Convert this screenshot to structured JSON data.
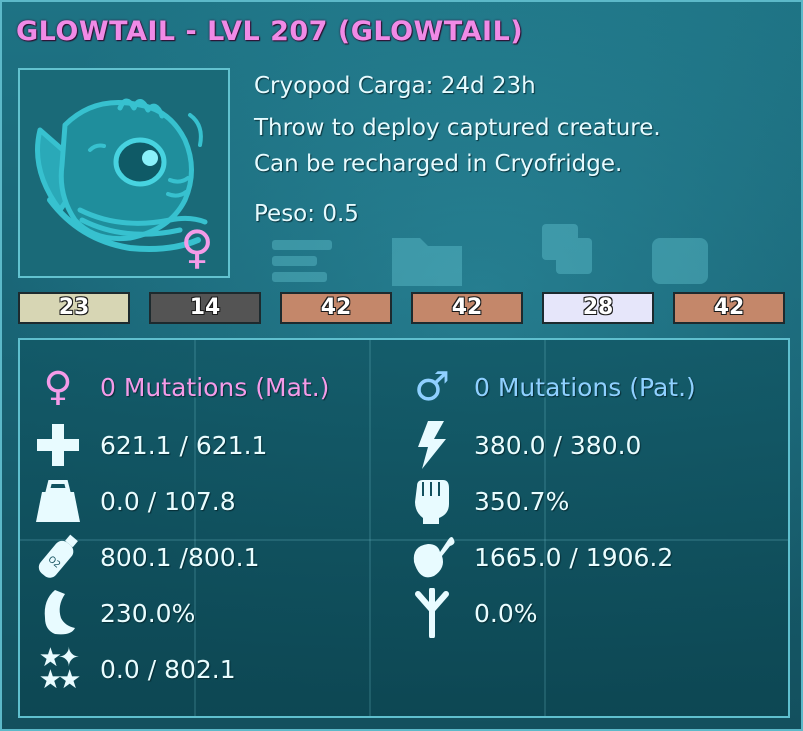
{
  "title": "GLOWTAIL - LVL 207 (GLOWTAIL)",
  "item": {
    "name_line": "Cryopod Carga: 24d 23h",
    "description_line1": "Throw to deploy captured creature.",
    "description_line2": "Can be recharged in Cryofridge.",
    "weight_line": "Peso: 0.5",
    "gender_icon": "female-symbol-icon"
  },
  "colors": [
    {
      "value": "23",
      "color": "#d7d6b4"
    },
    {
      "value": "14",
      "color": "#545454"
    },
    {
      "value": "42",
      "color": "#c4876a"
    },
    {
      "value": "42",
      "color": "#c4876a"
    },
    {
      "value": "28",
      "color": "#e6e6fa"
    },
    {
      "value": "42",
      "color": "#c4876a"
    }
  ],
  "stats": {
    "left": [
      {
        "icon": "female-symbol-icon",
        "text": "0 Mutations (Mat.)"
      },
      {
        "icon": "health-cross-icon",
        "text": "621.1 / 621.1"
      },
      {
        "icon": "weight-icon",
        "text": "0.0 / 107.8"
      },
      {
        "icon": "oxygen-tank-icon",
        "text": "800.1 /800.1"
      },
      {
        "icon": "foot-speed-icon",
        "text": "230.0%"
      },
      {
        "icon": "stars-torpor-icon",
        "text": "0.0 / 802.1"
      }
    ],
    "right": [
      {
        "icon": "male-symbol-icon",
        "text": "0 Mutations (Pat.)"
      },
      {
        "icon": "lightning-stamina-icon",
        "text": "380.0 / 380.0"
      },
      {
        "icon": "fist-melee-icon",
        "text": "350.7%"
      },
      {
        "icon": "meat-food-icon",
        "text": "1665.0 / 1906.2"
      },
      {
        "icon": "footprint-icon",
        "text": "0.0%"
      }
    ]
  },
  "accent_colors": {
    "title": "#f08ae6",
    "maternal": "#f49be8",
    "paternal": "#8fd0ff",
    "panel_border": "#5fbfce"
  }
}
